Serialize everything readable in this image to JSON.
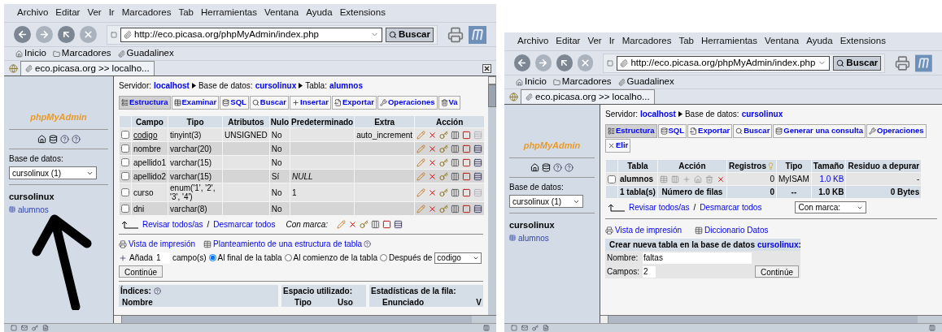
{
  "windows": [
    {
      "menu": [
        "Archivo",
        "Editar",
        "Ver",
        "Ir",
        "Marcadores",
        "Tab",
        "Herramientas",
        "Ventana",
        "Ayuda",
        "Extensions"
      ],
      "url": "http://eco.picasa.org/phpMyAdmin/index.php",
      "search_button": "Buscar",
      "bookmarks": [
        "Inicio",
        "Marcadores",
        "Guadalinex"
      ],
      "tab": "eco.picasa.org >> localho...",
      "closable": true,
      "sidebar": {
        "logo": "phpMyAdmin",
        "database_label": "Base de datos:",
        "database_value": "cursolinux (1)",
        "database_name": "cursolinux",
        "tables": [
          "alumnos"
        ],
        "annotation_arrow": true
      },
      "content": {
        "kind": "table_structure",
        "breadcrumb": [
          {
            "label": "Servidor:",
            "value": "localhost"
          },
          {
            "label": "Base de datos:",
            "value": "cursolinux"
          },
          {
            "label": "Tabla:",
            "value": "alumnos"
          }
        ],
        "tabs": [
          {
            "label": "Estructura",
            "selected": true
          },
          {
            "label": "Examinar",
            "selected": false
          },
          {
            "label": "SQL",
            "selected": false
          },
          {
            "label": "Buscar",
            "selected": false
          },
          {
            "label": "Insertar",
            "selected": false
          },
          {
            "label": "Exportar",
            "selected": false
          },
          {
            "label": "Operaciones",
            "selected": false
          },
          {
            "label": "Va",
            "selected": false
          }
        ],
        "columns": [
          "Campo",
          "Tipo",
          "Atributos",
          "Nulo",
          "Predeterminado",
          "Extra",
          "Acción"
        ],
        "rows": [
          {
            "checked": false,
            "primary": true,
            "fulltext_enabled": false,
            "campo": "codigo",
            "tipo": "tinyint(3)",
            "atributos": "UNSIGNED",
            "nulo": "No",
            "extra": "auto_increment"
          },
          {
            "checked": false,
            "primary": false,
            "fulltext_enabled": true,
            "campo": "nombre",
            "tipo": "varchar(20)",
            "nulo": "No"
          },
          {
            "checked": false,
            "primary": false,
            "fulltext_enabled": true,
            "campo": "apellido1",
            "tipo": "varchar(15)",
            "nulo": "No"
          },
          {
            "checked": false,
            "primary": false,
            "fulltext_enabled": true,
            "campo": "apellido2",
            "tipo": "varchar(15)",
            "nulo": "Sí",
            "predeterminado": "NULL",
            "default_is_null": true
          },
          {
            "checked": false,
            "primary": false,
            "fulltext_enabled": false,
            "campo": "curso",
            "tipo": "enum('1', '2', '3', '4')",
            "nulo": "No",
            "predeterminado": "1",
            "default_is_null": false
          },
          {
            "checked": false,
            "primary": false,
            "fulltext_enabled": true,
            "campo": "dni",
            "tipo": "varchar(8)",
            "nulo": "No"
          }
        ],
        "check_all": {
          "select_all": "Revisar todos/as",
          "separator": "/",
          "deselect_all": "Desmarcar todos",
          "with_selected": "Con marca:"
        },
        "links": [
          "Vista de impresión",
          "Planteamiento de una estructura de tabla"
        ],
        "add_field": {
          "label": "Añada",
          "count": "1",
          "unit": "campo(s)",
          "positions": [
            {
              "label": "Al final de la tabla",
              "selected": true
            },
            {
              "label": "Al comienzo de la tabla",
              "selected": false
            },
            {
              "label": "Después de",
              "selected": false
            }
          ],
          "after_field": "codigo",
          "button": "Continúe"
        },
        "footer": {
          "headings": [
            "Índices:",
            "Espacio utilizado:",
            "Estadísticas de la fila:"
          ],
          "subheadings": [
            "Nombre",
            "Tipo",
            "Uso",
            "Enunciado",
            "V"
          ]
        }
      }
    },
    {
      "menu": [
        "Archivo",
        "Editar",
        "Ver",
        "Ir",
        "Marcadores",
        "Tab",
        "Herramientas",
        "Ventana",
        "Ayuda",
        "Extensions"
      ],
      "url": "http://eco.picasa.org/phpMyAdmin/index.php",
      "search_button": "Buscar",
      "bookmarks": [
        "Inicio",
        "Marcadores",
        "Guadalinex"
      ],
      "tab": "eco.picasa.org >> localho...",
      "closable": false,
      "sidebar": {
        "logo": "phpMyAdmin",
        "database_label": "Base de datos:",
        "database_value": "cursolinux (1)",
        "database_name": "cursolinux",
        "tables": [
          "alumnos"
        ],
        "annotation_arrow": false
      },
      "content": {
        "kind": "database_structure",
        "breadcrumb": [
          {
            "label": "Servidor:",
            "value": "localhost"
          },
          {
            "label": "Base de datos:",
            "value": "cursolinux"
          }
        ],
        "tabs": [
          {
            "label": "Estructura",
            "selected": true
          },
          {
            "label": "SQL",
            "selected": false
          },
          {
            "label": "Exportar",
            "selected": false
          },
          {
            "label": "Buscar",
            "selected": false
          },
          {
            "label": "Generar una consulta",
            "selected": false
          },
          {
            "label": "Operaciones",
            "selected": false
          },
          {
            "label": "Elir",
            "selected": false
          }
        ],
        "columns": [
          "Tabla",
          "Acción",
          "Registros",
          "Tipo",
          "Tamaño",
          "Residuo a depurar"
        ],
        "rows": [
          {
            "checked": false,
            "name": "alumnos",
            "registros": "0",
            "tipo": "MyISAM",
            "tamano": "1.0 KB",
            "residuo": "-"
          }
        ],
        "summary": {
          "tabla": "1 tabla(s)",
          "accion": "Número de filas",
          "registros": "0",
          "tipo": "--",
          "tamano": "1.0 KB",
          "residuo": "0 Bytes"
        },
        "check_all": {
          "select_all": "Revisar todos/as",
          "separator": "/",
          "deselect_all": "Desmarcar todos",
          "with_selected": "Con marca:"
        },
        "links": [
          "Vista de impresión",
          "Diccionario Datos"
        ],
        "create_table": {
          "title": "Crear nueva tabla en la base de datos",
          "database": "cursolinux",
          "suffix": ":",
          "name_label": "Nombre:",
          "name_value": "faltas",
          "fields_label": "Campos:",
          "fields_value": "2",
          "button": "Continúe"
        }
      }
    }
  ]
}
